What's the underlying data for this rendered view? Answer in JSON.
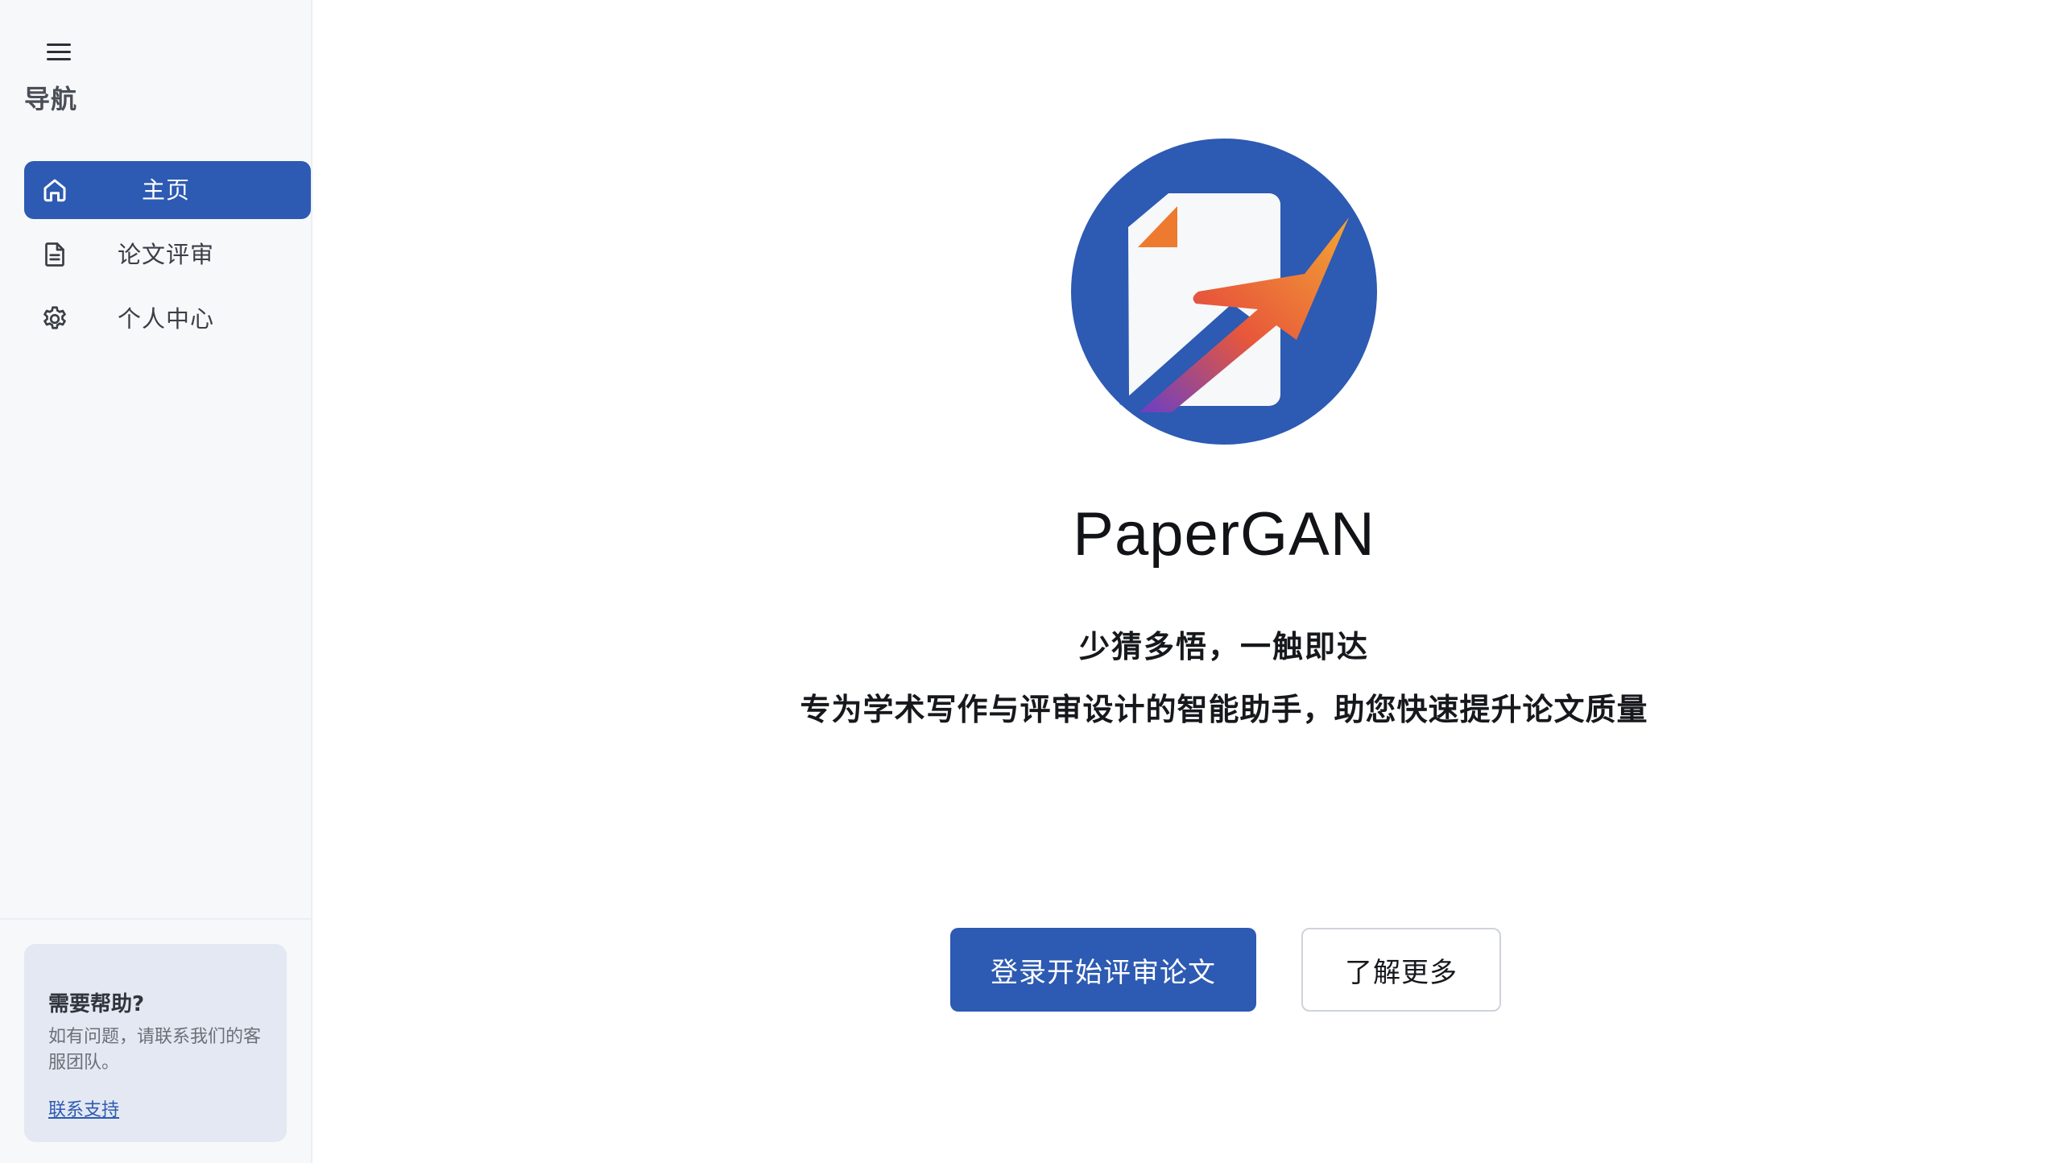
{
  "sidebar": {
    "menu_icon": "hamburger-menu-icon",
    "title": "导航",
    "items": [
      {
        "label": "主页",
        "icon": "home-icon",
        "active": true
      },
      {
        "label": "论文评审",
        "icon": "document-icon",
        "active": false
      },
      {
        "label": "个人中心",
        "icon": "gear-icon",
        "active": false
      }
    ],
    "help": {
      "title": "需要帮助?",
      "description": "如有问题，请联系我们的客服团队。",
      "link": "联系支持"
    }
  },
  "main": {
    "logo_icon": "papergan-logo",
    "title": "PaperGAN",
    "tagline": "少猜多悟，一触即达",
    "subtitle": "专为学术写作与评审设计的智能助手，助您快速提升论文质量",
    "primary_button": "登录开始评审论文",
    "secondary_button": "了解更多"
  },
  "colors": {
    "accent": "#2d5ab2",
    "sidebar_bg": "#f7f8fa",
    "help_card_bg": "#e3e8f2",
    "logo_orange": "#ee7a2f",
    "logo_purple": "#7a45c8"
  }
}
